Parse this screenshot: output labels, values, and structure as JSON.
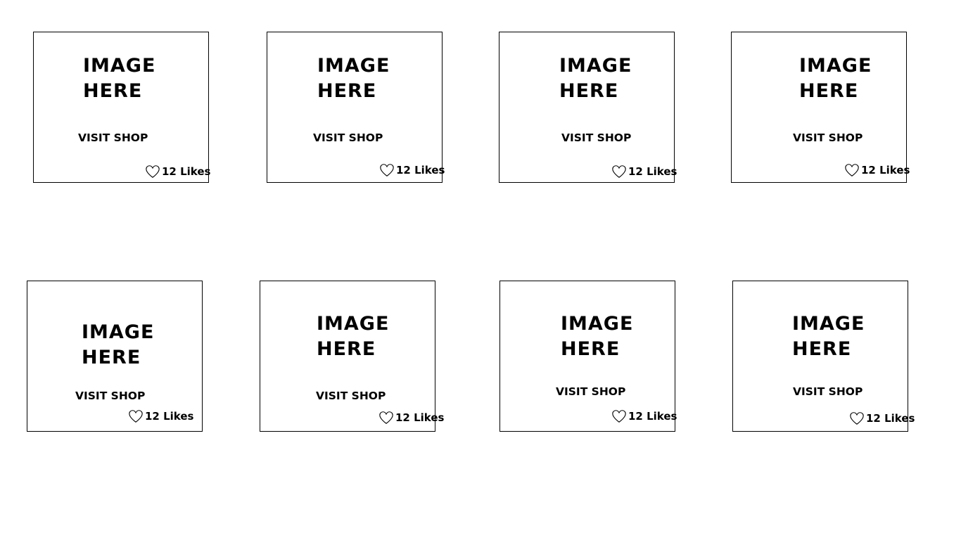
{
  "cards": [
    {
      "image_text": "IMAGE\nHERE",
      "visit_label": "VISIT SHOP",
      "likes_label": "12 Likes",
      "icon": "heart-outline-icon"
    },
    {
      "image_text": "IMAGE\nHERE",
      "visit_label": "VISIT SHOP",
      "likes_label": "12 Likes",
      "icon": "heart-outline-icon"
    },
    {
      "image_text": "IMAGE\nHERE",
      "visit_label": "VISIT SHOP",
      "likes_label": "12 Likes",
      "icon": "heart-outline-icon"
    },
    {
      "image_text": "IMAGE\nHERE",
      "visit_label": "VISIT SHOP",
      "likes_label": "12 Likes",
      "icon": "heart-outline-icon"
    },
    {
      "image_text": "IMAGE\nHERE",
      "visit_label": "VISIT SHOP",
      "likes_label": "12 Likes",
      "icon": "heart-outline-icon"
    },
    {
      "image_text": "IMAGE\nHERE",
      "visit_label": "VISIT SHOP",
      "likes_label": "12 Likes",
      "icon": "heart-outline-icon"
    },
    {
      "image_text": "IMAGE\nHERE",
      "visit_label": "VISIT SHOP",
      "likes_label": "12 Likes",
      "icon": "heart-outline-icon"
    },
    {
      "image_text": "IMAGE\nHERE",
      "visit_label": "VISIT SHOP",
      "likes_label": "12 Likes",
      "icon": "heart-outline-icon"
    }
  ]
}
